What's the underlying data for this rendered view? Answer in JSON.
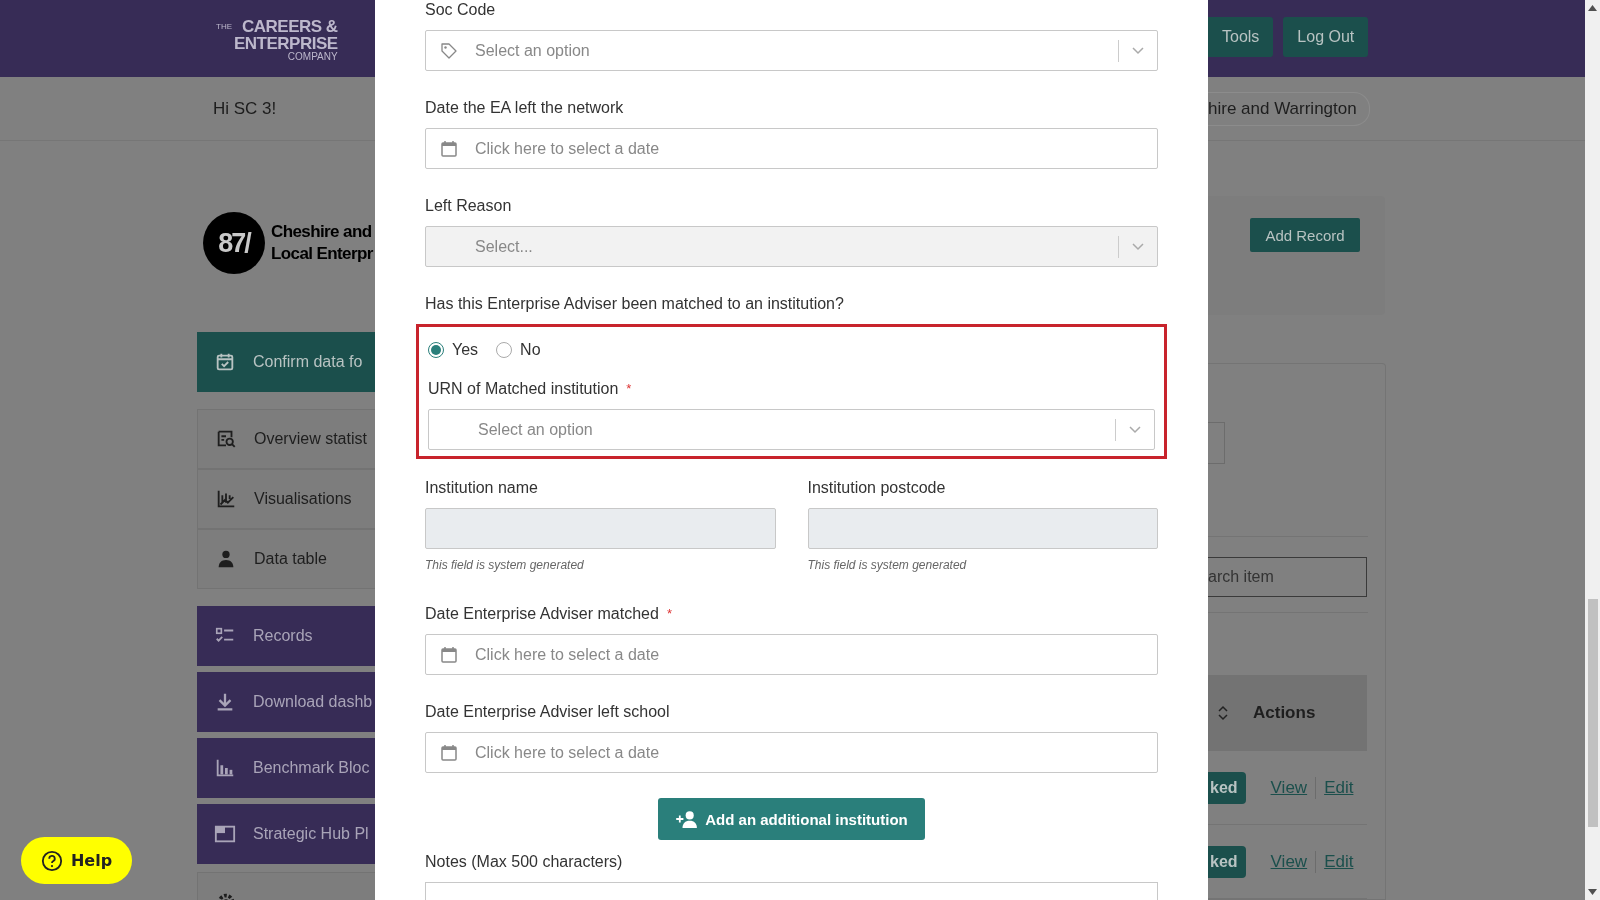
{
  "header": {
    "logo": {
      "small": "THE",
      "line_1": "CAREERS &",
      "line_2": "ENTERPRISE",
      "line_3": "COMPANY"
    },
    "buttons": [
      "Tools",
      "Log Out"
    ]
  },
  "greeting": "Hi SC 3!",
  "region_pill": "hire and Warrington",
  "organisation": {
    "badge": "87/",
    "name_lines": [
      "Cheshire and",
      "Local Enterpr"
    ]
  },
  "sidebar": {
    "items": [
      {
        "label": "Confirm data fo",
        "kind": "highlight"
      },
      {
        "label": "Overview statist",
        "kind": "plain"
      },
      {
        "label": "Visualisations",
        "kind": "plain"
      },
      {
        "label": "Data table",
        "kind": "plain"
      },
      {
        "label": "Records",
        "kind": "purple"
      },
      {
        "label": "Download dashb",
        "kind": "purple"
      },
      {
        "label": "Benchmark Bloc",
        "kind": "purple"
      },
      {
        "label": "Strategic Hub Pl",
        "kind": "purple"
      }
    ]
  },
  "help_button": "Help",
  "records_panel": {
    "add_button": "Add Record",
    "search_placeholder": "arch item",
    "columns": [
      "Actions"
    ],
    "rows": [
      {
        "status": "ked",
        "actions": [
          "View",
          "Edit"
        ]
      },
      {
        "status": "ked",
        "actions": [
          "View",
          "Edit"
        ]
      }
    ]
  },
  "modal": {
    "fields": [
      {
        "kind": "tagselect",
        "label": "Soc Code",
        "placeholder": "Select an option",
        "disabled": false
      },
      {
        "kind": "date",
        "label": "Date the EA left the network",
        "placeholder": "Click here to select a date"
      },
      {
        "kind": "select",
        "label": "Left Reason",
        "placeholder": "Select...",
        "disabled": true
      },
      {
        "kind": "question",
        "label": "Has this Enterprise Adviser been matched to an institution?"
      },
      {
        "kind": "group",
        "highlighted": true,
        "fields": [
          {
            "kind": "radios",
            "options": [
              {
                "label": "Yes",
                "selected": true
              },
              {
                "label": "No",
                "selected": false
              }
            ]
          },
          {
            "kind": "select",
            "label": "URN of Matched institution",
            "required_mark": "*",
            "placeholder": "Select an option",
            "disabled": false
          }
        ]
      },
      {
        "kind": "pair",
        "fields": [
          {
            "label": "Institution name",
            "hint": "This field is system generated"
          },
          {
            "label": "Institution postcode",
            "hint": "This field is system generated"
          }
        ]
      },
      {
        "kind": "date",
        "label": "Date Enterprise Adviser matched",
        "required_mark": "*",
        "placeholder": "Click here to select a date"
      },
      {
        "kind": "date",
        "label": "Date Enterprise Adviser left school",
        "placeholder": "Click here to select a date"
      },
      {
        "kind": "button",
        "label": "Add an additional institution"
      },
      {
        "kind": "textarea",
        "label": "Notes (Max 500 characters)"
      }
    ]
  }
}
